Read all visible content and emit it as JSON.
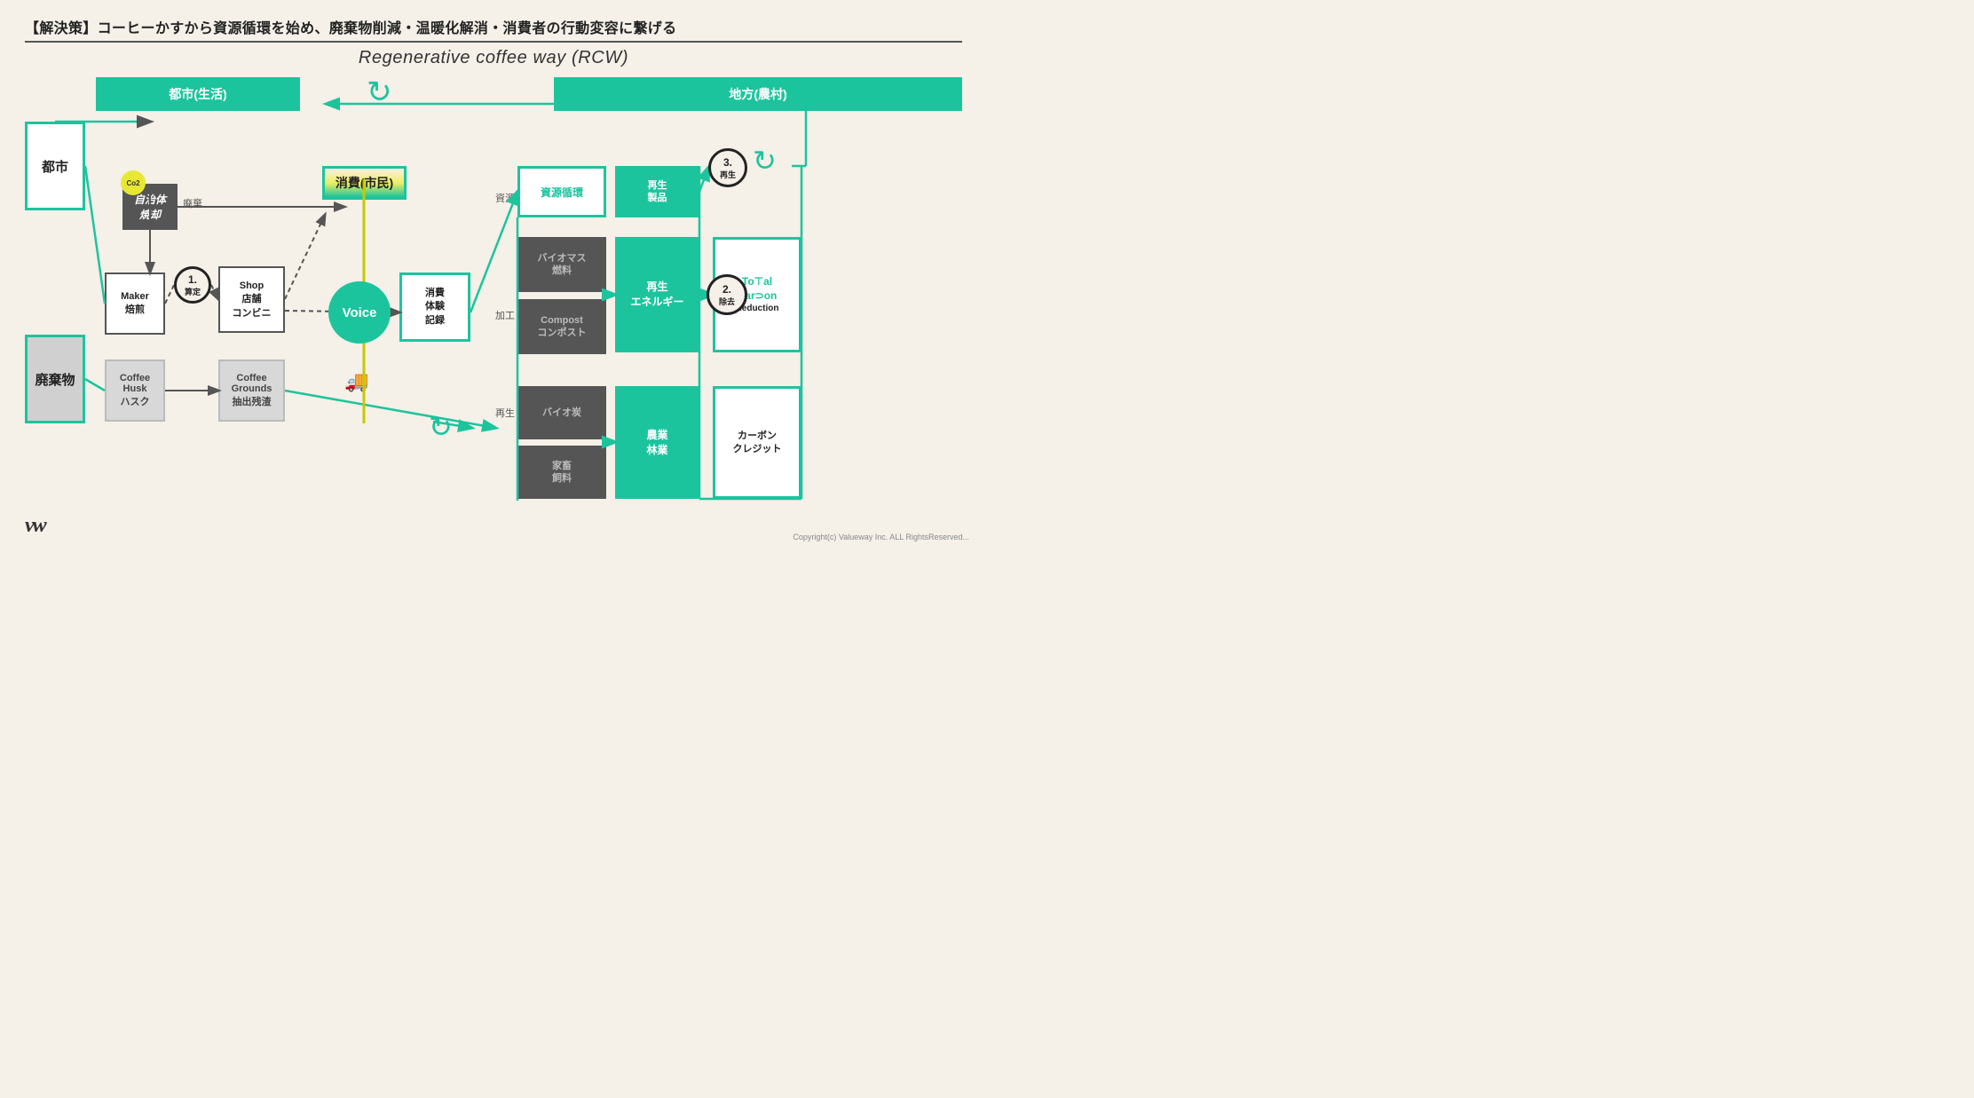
{
  "page": {
    "title": "【解決策】コーヒーかすから資源循環を始め、廃棄物削減・温暖化解消・消費者の行動変容に繋げる",
    "subtitle": "Regenerative coffee way (RCW)",
    "copyright": "Copyright(c) Valueway Inc. ALL RightsReserved..."
  },
  "left_col": {
    "city_label": "都市",
    "waste_label": "廃棄物"
  },
  "toshi_section": {
    "label": "都市(生活)"
  },
  "chihou_section": {
    "label": "地方(農村)"
  },
  "jichitai": {
    "line1": "自治体",
    "line2": "焼却",
    "co2": "Co2",
    "haiki": "廃棄"
  },
  "maker": {
    "line1": "Maker",
    "line2": "焙煎"
  },
  "shop": {
    "line1": "Shop",
    "line2": "店舗",
    "line3": "コンビニ"
  },
  "coffee_husk": {
    "line1": "Coffee",
    "line2": "Husk",
    "line3": "ハスク"
  },
  "coffee_grounds": {
    "line1": "Coffee",
    "line2": "Grounds",
    "line3": "抽出残渣"
  },
  "shohi": {
    "label": "消費(市民)"
  },
  "voice": {
    "label": "Voice"
  },
  "shohi_taiken": {
    "line1": "消費",
    "line2": "体験",
    "line3": "記録"
  },
  "circle1": {
    "num": "1.",
    "label": "算定"
  },
  "circle2": {
    "num": "2.",
    "label": "除去"
  },
  "circle3": {
    "num": "3.",
    "label": "再生"
  },
  "shigen_junkan": {
    "label": "資源循環"
  },
  "saisei_product": {
    "line1": "再生",
    "line2": "製品"
  },
  "biomass": {
    "line1": "バイオマス",
    "line2": "燃料"
  },
  "compost": {
    "line1": "Compost",
    "line2": "コンポスト"
  },
  "biotan": {
    "line1": "バイオ炭"
  },
  "kachiku": {
    "line1": "家畜",
    "line2": "飼料"
  },
  "saisei_energy": {
    "line1": "再生",
    "line2": "エネルギー"
  },
  "nougyo": {
    "line1": "農業",
    "line2": "林業"
  },
  "total_carbon": {
    "line1": "To⊤al",
    "line2": "Car⊃on",
    "line3": "Reduction"
  },
  "carbon_credit": {
    "line1": "カーボン",
    "line2": "クレジット"
  },
  "labels": {
    "shigen": "資源",
    "kako": "加工",
    "saisei": "再生"
  },
  "logo": "vw"
}
